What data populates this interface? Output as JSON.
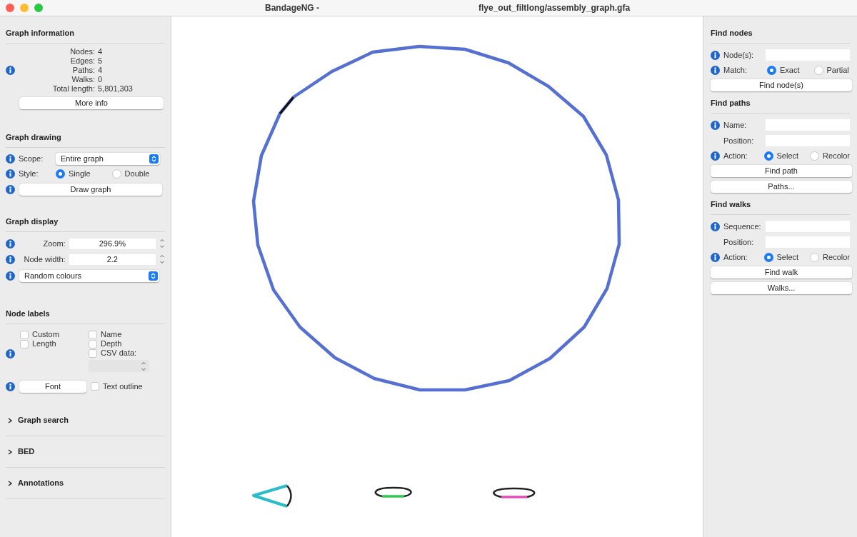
{
  "window": {
    "app_title": "BandageNG -",
    "file_title": "flye_out_filtlong/assembly_graph.gfa"
  },
  "left_panel": {
    "graph_information": {
      "title": "Graph information",
      "stats": [
        {
          "label": "Nodes:",
          "value": "4"
        },
        {
          "label": "Edges:",
          "value": "5"
        },
        {
          "label": "Paths:",
          "value": "4"
        },
        {
          "label": "Walks:",
          "value": "0"
        },
        {
          "label": "Total length:",
          "value": "5,801,303"
        }
      ],
      "button": "More info"
    },
    "graph_drawing": {
      "title": "Graph drawing",
      "scope_label": "Scope:",
      "scope_value": "Entire graph",
      "style_label": "Style:",
      "style_options": [
        {
          "label": "Single",
          "selected": true
        },
        {
          "label": "Double",
          "selected": false
        }
      ],
      "button": "Draw graph"
    },
    "graph_display": {
      "title": "Graph display",
      "zoom_label": "Zoom:",
      "zoom_value": "296.9%",
      "node_width_label": "Node width:",
      "node_width_value": "2.2",
      "colour_scheme": "Random colours"
    },
    "node_labels": {
      "title": "Node labels",
      "left_checkboxes": [
        {
          "label": "Custom",
          "checked": false
        },
        {
          "label": "Length",
          "checked": false
        }
      ],
      "right_checkboxes": [
        {
          "label": "Name",
          "checked": false
        },
        {
          "label": "Depth",
          "checked": false
        },
        {
          "label": "CSV data:",
          "checked": false
        }
      ],
      "font_button": "Font",
      "text_outline": {
        "label": "Text outline",
        "checked": false
      }
    },
    "collapsed_sections": [
      {
        "label": "Graph search",
        "expanded": false
      },
      {
        "label": "BED",
        "expanded": false
      },
      {
        "label": "Annotations",
        "expanded": false
      }
    ]
  },
  "right_panel": {
    "find_nodes": {
      "title": "Find nodes",
      "nodes_label": "Node(s):",
      "match_label": "Match:",
      "match_options": [
        {
          "label": "Exact",
          "selected": true
        },
        {
          "label": "Partial",
          "selected": false
        }
      ],
      "button": "Find node(s)"
    },
    "find_paths": {
      "title": "Find paths",
      "name_label": "Name:",
      "position_label": "Position:",
      "action_label": "Action:",
      "action_options": [
        {
          "label": "Select",
          "selected": true
        },
        {
          "label": "Recolor",
          "selected": false
        }
      ],
      "buttons": [
        "Find path",
        "Paths..."
      ]
    },
    "find_walks": {
      "title": "Find walks",
      "sequence_label": "Sequence:",
      "position_label": "Position:",
      "action_label": "Action:",
      "action_options": [
        {
          "label": "Select",
          "selected": true
        },
        {
          "label": "Recolor",
          "selected": false
        }
      ],
      "buttons": [
        "Find walk",
        "Walks..."
      ]
    }
  }
}
